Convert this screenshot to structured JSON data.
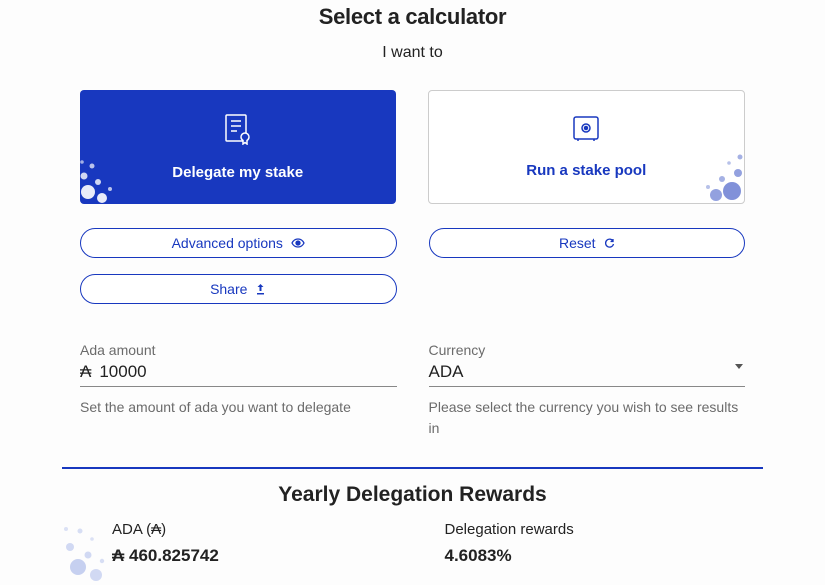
{
  "header": {
    "title": "Select a calculator",
    "subtitle": "I want to"
  },
  "cards": {
    "delegate": "Delegate my stake",
    "pool": "Run a stake pool"
  },
  "buttons": {
    "advanced": "Advanced options",
    "reset": "Reset",
    "share": "Share"
  },
  "fields": {
    "amount": {
      "label": "Ada amount",
      "prefix": "₳",
      "value": "10000",
      "help": "Set the amount of ada you want to delegate"
    },
    "currency": {
      "label": "Currency",
      "value": "ADA",
      "help": "Please select the currency you wish to see results in"
    }
  },
  "rewards": {
    "title": "Yearly Delegation Rewards",
    "ada": {
      "label": "ADA (₳)",
      "value": "₳ 460.825742"
    },
    "delegation": {
      "label": "Delegation rewards",
      "value": "4.6083%"
    }
  }
}
